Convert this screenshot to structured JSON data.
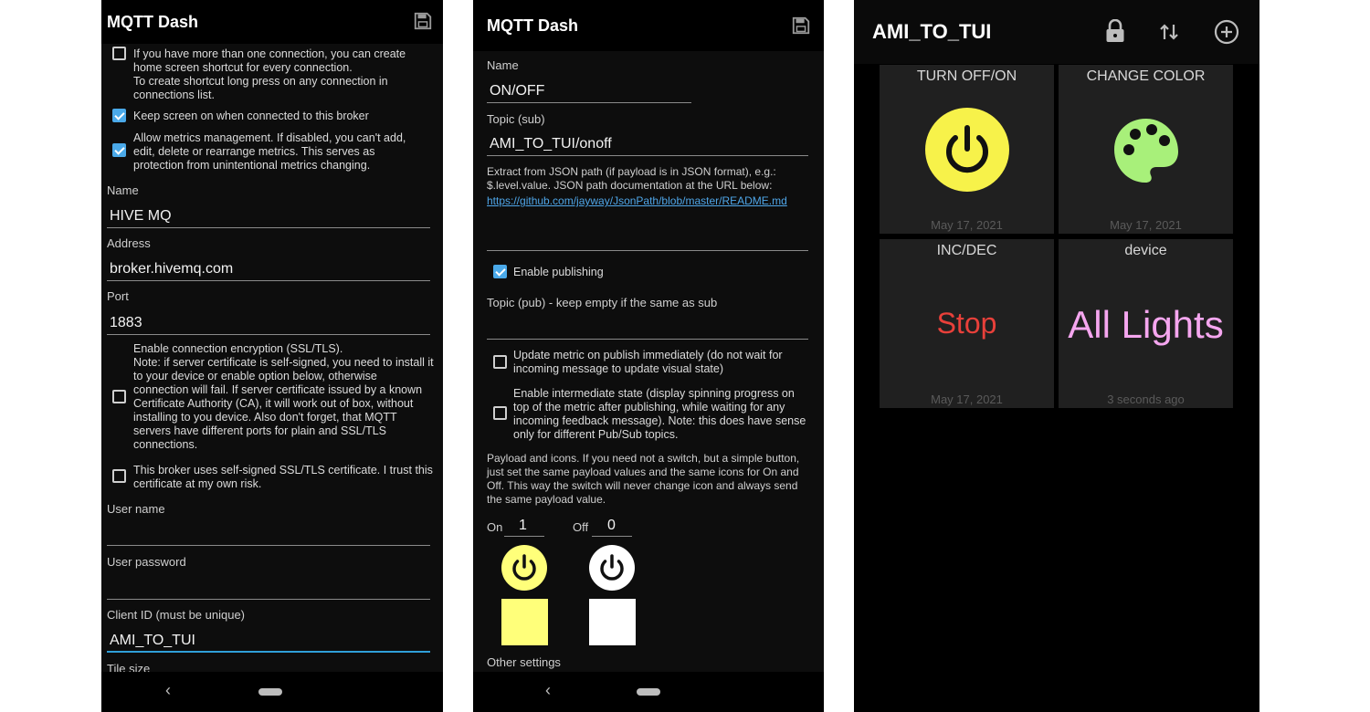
{
  "left": {
    "app_title": "MQTT Dash",
    "shortcut_text": "If you have more than one connection, you can create home screen shortcut for every connection.\nTo create shortcut long press on any connection in connections list.",
    "keep_screen": "Keep screen on when connected to this broker",
    "metrics_mgmt": "Allow metrics management. If disabled, you can't add, edit, delete or rearrange metrics. This serves as protection from unintentional metrics changing.",
    "name_label": "Name",
    "name_value": "HIVE MQ",
    "address_label": "Address",
    "address_value": "broker.hivemq.com",
    "port_label": "Port",
    "port_value": "1883",
    "encryption_text": "Enable connection encryption (SSL/TLS).\nNote: if server certificate is self-signed, you need to install it to your device or enable option below, otherwise connection will fail. If server certificate issued by a known Certificate Authority (CA), it will work out of box, without installing to you device. Also don't forget, that MQTT servers have different ports for plain and SSL/TLS connections.",
    "selfsigned_text": "This broker uses self-signed SSL/TLS certificate. I trust this certificate at my own risk.",
    "username_label": "User name",
    "password_label": "User password",
    "clientid_label": "Client ID (must be unique)",
    "clientid_value": "AMI_TO_TUI",
    "tilesize_label": "Tile size",
    "nav_back": "‹"
  },
  "middle": {
    "app_title": "MQTT Dash",
    "name_label": "Name",
    "name_value": "ON/OFF",
    "topic_sub_label": "Topic (sub)",
    "topic_sub_value": "AMI_TO_TUI/onoff",
    "json_hint": "Extract from JSON path (if payload is in JSON format), e.g.: $.level.value. JSON path documentation at the URL below:",
    "json_link": "https://github.com/jayway/JsonPath/blob/master/README.md",
    "enable_publishing": "Enable publishing",
    "topic_pub_label": "Topic (pub) - keep empty if the same as sub",
    "update_metric": "Update metric on publish immediately (do not wait for incoming message to update visual state)",
    "intermediate_state": "Enable intermediate state (display spinning progress on top of the metric after publishing, while waiting for any incoming feedback message). Note: this does have sense only for different Pub/Sub topics.",
    "payload_text": "Payload and icons. If you need not a switch, but a simple button, just set the same payload values and the same icons for On and Off. This way the switch will never change icon and always send the same payload value.",
    "on_label": "On",
    "on_value": "1",
    "off_label": "Off",
    "off_value": "0",
    "on_color": "#ffff7a",
    "off_color": "#ffffff",
    "other_settings": "Other settings",
    "nav_back": "‹"
  },
  "right": {
    "app_title": "AMI_TO_TUI",
    "tiles": [
      {
        "title": "TURN OFF/ON",
        "date": "May 17, 2021"
      },
      {
        "title": "CHANGE COLOR",
        "date": "May 17, 2021"
      },
      {
        "title": "INC/DEC",
        "value": "Stop",
        "date": "May 17, 2021"
      },
      {
        "title": "device",
        "value": "All Lights",
        "date": "3 seconds ago"
      }
    ],
    "power_color": "#f7f24a",
    "palette_color": "#a8f07a",
    "stop_color": "#e8403a",
    "lights_color": "#f5a6ef"
  }
}
